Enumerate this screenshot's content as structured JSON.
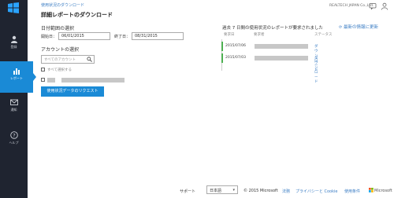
{
  "header": {
    "breadcrumb": "使用状況のダウンロード",
    "title": "詳細レポートのダウンロード",
    "company": "REALTECH JAPAN Co.,Ltd."
  },
  "sidebar": {
    "items": [
      {
        "label": "登録",
        "icon": "user-icon"
      },
      {
        "label": "レポート",
        "icon": "report-icon"
      },
      {
        "label": "通知",
        "icon": "mail-icon"
      },
      {
        "label": "ヘルプ",
        "icon": "help-icon"
      }
    ],
    "active_index": 1
  },
  "form": {
    "date_range_label": "日付範囲の選択",
    "start_label": "開始日：",
    "start_value": "06/01/2015",
    "end_label": "終了日：",
    "end_value": "08/31/2015",
    "account_label": "アカウントの選択",
    "search_placeholder": "すべてのアカウント",
    "select_all_label": "すべて選択する",
    "submit_label": "使用状況データのリクエスト"
  },
  "reports": {
    "title": "過去 7 日間の使用状況のレポートが要求されました",
    "refresh_link": "最新の情報に更新",
    "columns": [
      "要求日",
      "要求者",
      "ステータス"
    ],
    "rows": [
      {
        "date": "2015/07/06",
        "status": "ダウンロード"
      },
      {
        "date": "2015/07/03",
        "status": "ダウンロード"
      }
    ]
  },
  "footer": {
    "support": "サポート",
    "language": "日本語",
    "copyright": "© 2015 Microsoft",
    "links": [
      "法務",
      "プライバシーと Cookie",
      "使用条件"
    ],
    "brand": "Microsoft"
  },
  "colors": {
    "sidebar_bg": "#1f2430",
    "accent": "#1a8ad6",
    "link": "#3b7dc4",
    "status_bar": "#4caf50"
  }
}
